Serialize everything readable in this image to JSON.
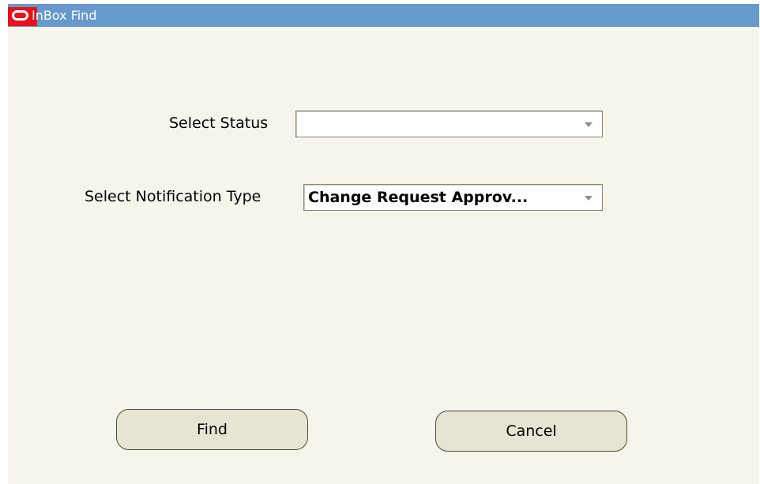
{
  "window": {
    "title": "InBox Find",
    "logo_icon": "oracle-logo-icon",
    "title_bar_color": "#6699cc",
    "background_color": "#f5f5ec"
  },
  "form": {
    "status": {
      "label": "Select Status",
      "value": ""
    },
    "notification_type": {
      "label": "Select Notification Type",
      "value": "Change Request Approv..."
    }
  },
  "buttons": {
    "find_label": "Find",
    "cancel_label": "Cancel"
  }
}
